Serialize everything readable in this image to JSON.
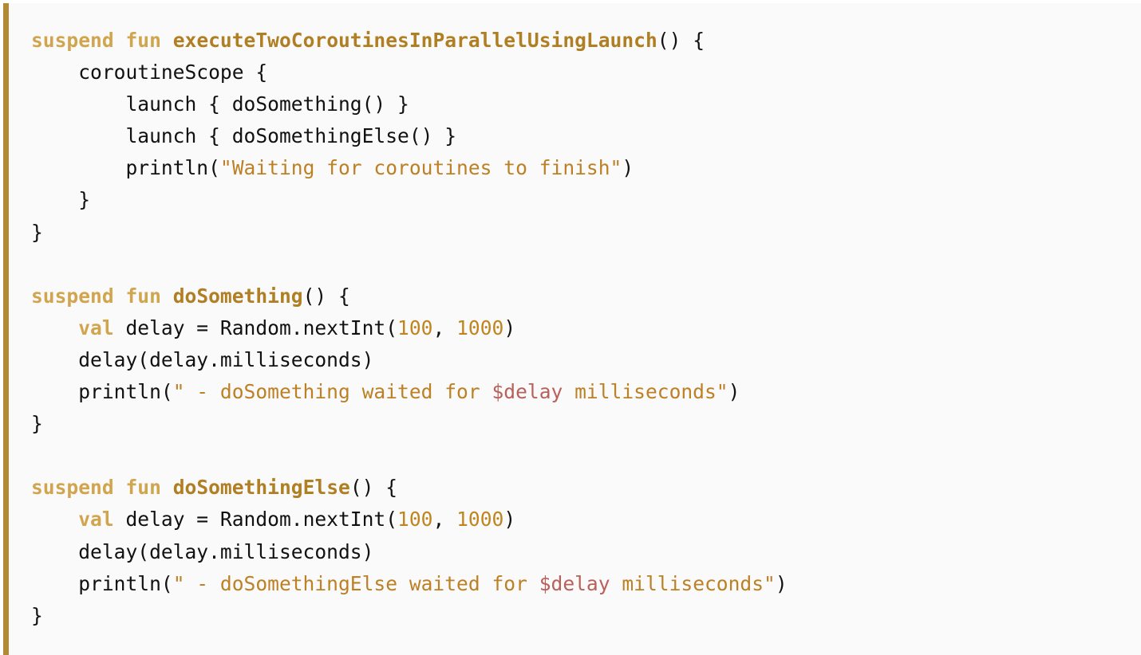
{
  "code": {
    "language": "kotlin",
    "lines": [
      [
        {
          "t": "kw",
          "v": "suspend"
        },
        {
          "t": "plain",
          "v": " "
        },
        {
          "t": "kw",
          "v": "fun"
        },
        {
          "t": "plain",
          "v": " "
        },
        {
          "t": "fn",
          "v": "executeTwoCoroutinesInParallelUsingLaunch"
        },
        {
          "t": "plain",
          "v": "() {"
        }
      ],
      [
        {
          "t": "plain",
          "v": "    coroutineScope {"
        }
      ],
      [
        {
          "t": "plain",
          "v": "        launch { doSomething() }"
        }
      ],
      [
        {
          "t": "plain",
          "v": "        launch { doSomethingElse() }"
        }
      ],
      [
        {
          "t": "plain",
          "v": "        println("
        },
        {
          "t": "str",
          "v": "\"Waiting for coroutines to finish\""
        },
        {
          "t": "plain",
          "v": ")"
        }
      ],
      [
        {
          "t": "plain",
          "v": "    }"
        }
      ],
      [
        {
          "t": "plain",
          "v": "}"
        }
      ],
      [
        {
          "t": "plain",
          "v": ""
        }
      ],
      [
        {
          "t": "kw",
          "v": "suspend"
        },
        {
          "t": "plain",
          "v": " "
        },
        {
          "t": "kw",
          "v": "fun"
        },
        {
          "t": "plain",
          "v": " "
        },
        {
          "t": "fn",
          "v": "doSomething"
        },
        {
          "t": "plain",
          "v": "() {"
        }
      ],
      [
        {
          "t": "plain",
          "v": "    "
        },
        {
          "t": "kw",
          "v": "val"
        },
        {
          "t": "plain",
          "v": " delay = Random.nextInt("
        },
        {
          "t": "num",
          "v": "100"
        },
        {
          "t": "plain",
          "v": ", "
        },
        {
          "t": "num",
          "v": "1000"
        },
        {
          "t": "plain",
          "v": ")"
        }
      ],
      [
        {
          "t": "plain",
          "v": "    delay(delay.milliseconds)"
        }
      ],
      [
        {
          "t": "plain",
          "v": "    println("
        },
        {
          "t": "str",
          "v": "\" - doSomething waited for "
        },
        {
          "t": "interp",
          "v": "$delay"
        },
        {
          "t": "str",
          "v": " milliseconds\""
        },
        {
          "t": "plain",
          "v": ")"
        }
      ],
      [
        {
          "t": "plain",
          "v": "}"
        }
      ],
      [
        {
          "t": "plain",
          "v": ""
        }
      ],
      [
        {
          "t": "kw",
          "v": "suspend"
        },
        {
          "t": "plain",
          "v": " "
        },
        {
          "t": "kw",
          "v": "fun"
        },
        {
          "t": "plain",
          "v": " "
        },
        {
          "t": "fn",
          "v": "doSomethingElse"
        },
        {
          "t": "plain",
          "v": "() {"
        }
      ],
      [
        {
          "t": "plain",
          "v": "    "
        },
        {
          "t": "kw",
          "v": "val"
        },
        {
          "t": "plain",
          "v": " delay = Random.nextInt("
        },
        {
          "t": "num",
          "v": "100"
        },
        {
          "t": "plain",
          "v": ", "
        },
        {
          "t": "num",
          "v": "1000"
        },
        {
          "t": "plain",
          "v": ")"
        }
      ],
      [
        {
          "t": "plain",
          "v": "    delay(delay.milliseconds)"
        }
      ],
      [
        {
          "t": "plain",
          "v": "    println("
        },
        {
          "t": "str",
          "v": "\" - doSomethingElse waited for "
        },
        {
          "t": "interp",
          "v": "$delay"
        },
        {
          "t": "str",
          "v": " milliseconds\""
        },
        {
          "t": "plain",
          "v": ")"
        }
      ],
      [
        {
          "t": "plain",
          "v": "}"
        }
      ]
    ]
  },
  "colors": {
    "border_accent": "#b28a34",
    "keyword": "#d1a54e",
    "function_name": "#b07f23",
    "string": "#bd8024",
    "number": "#c0851f",
    "interpolation": "#b9605a",
    "text": "#111111",
    "background": "#fafafa"
  }
}
